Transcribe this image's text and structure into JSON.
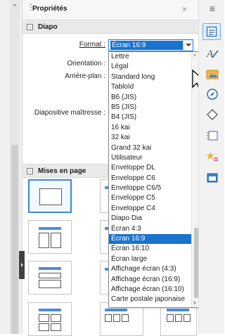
{
  "panel": {
    "title": "Propriétés",
    "close_glyph": "×",
    "menu_glyph": "≡",
    "grip_glyph": "⋮"
  },
  "slide_section": {
    "title": "Diapo",
    "collapse_glyph": "−",
    "format_label": "Format :",
    "format_value": "Écran 16:9",
    "orientation_label": "Orientation :",
    "background_label": "Arrière-plan :",
    "master_label": "Diapositive maîtresse :"
  },
  "format_dropdown": {
    "options": [
      "Lettre",
      "Légal",
      "Standard long",
      "Tabloïd",
      "B6 (JIS)",
      "B5 (JIS)",
      "B4 (JIS)",
      "16 kai",
      "32 kai",
      "Grand 32 kai",
      "Utilisateur",
      "Enveloppe DL",
      "Enveloppe C6",
      "Enveloppe C6/5",
      "Enveloppe C5",
      "Enveloppe C4",
      "Diapo Dia",
      "Écran 4:3",
      "Écran 16:9",
      "Écran 16:10",
      "Écran large",
      "Affichage écran (4:3)",
      "Affichage écran (16:9)",
      "Affichage écran (16:10)",
      "Carte postale japonaise"
    ],
    "selected_index": 18,
    "selected": "Écran 16:9"
  },
  "layouts_section": {
    "title": "Mises en page",
    "collapse_glyph": "−"
  },
  "scroll_glyphs": {
    "up": "^",
    "down": "v"
  },
  "colors": {
    "accent": "#1a73cf",
    "panel_bg": "#ffffff",
    "section_bg": "#e9e9e9",
    "tab_active_border": "#7aa2d6"
  },
  "tabbar_icons": [
    "properties-icon",
    "styles-icon",
    "gallery-icon",
    "navigator-icon",
    "shapes-icon",
    "master-slides-icon",
    "animation-icon",
    "slide-transition-icon"
  ]
}
